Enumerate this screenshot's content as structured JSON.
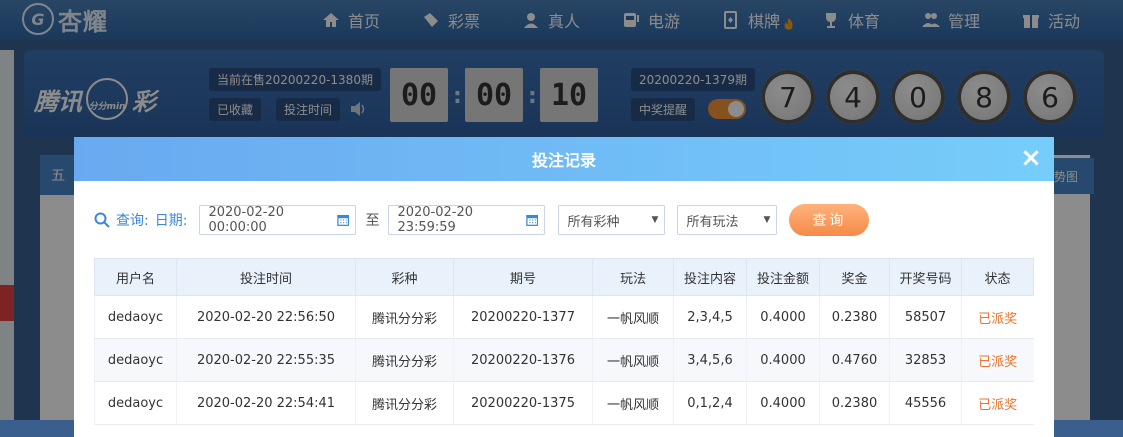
{
  "nav": {
    "logo": "杏耀",
    "items": [
      {
        "label": "首页",
        "icon": "home-icon"
      },
      {
        "label": "彩票",
        "icon": "ticket-icon"
      },
      {
        "label": "真人",
        "icon": "person-icon"
      },
      {
        "label": "电游",
        "icon": "slot-machine-icon"
      },
      {
        "label": "棋牌",
        "icon": "card-icon"
      },
      {
        "label": "体育",
        "icon": "trophy-icon"
      },
      {
        "label": "管理",
        "icon": "users-icon"
      },
      {
        "label": "活动",
        "icon": "gift-icon"
      }
    ]
  },
  "lottery": {
    "brand": "腾讯",
    "brand_suffix": "彩",
    "brand_clock": "分分min",
    "current_period": "当前在售20200220-1380期",
    "collected": "已收藏",
    "bet_time": "投注时间",
    "countdown": [
      "00",
      "00",
      "10"
    ],
    "last_period": "20200220-1379期",
    "win_alert": "中奖提醒",
    "balls": [
      "7",
      "4",
      "0",
      "8",
      "6"
    ]
  },
  "background": {
    "left_tab": "五",
    "right_tab": "势图"
  },
  "modal": {
    "title": "投注记录",
    "close": "×",
    "query_label": "查询:",
    "date_label": "日期:",
    "start_date": "2020-02-20 00:00:00",
    "to": "至",
    "end_date": "2020-02-20 23:59:59",
    "lottery_select": "所有彩种",
    "play_select": "所有玩法",
    "query_button": "查询",
    "columns": [
      "用户名",
      "投注时间",
      "彩种",
      "期号",
      "玩法",
      "投注内容",
      "投注金额",
      "奖金",
      "开奖号码",
      "状态"
    ],
    "rows": [
      [
        "dedaoyc",
        "2020-02-20 22:56:50",
        "腾讯分分彩",
        "20200220-1377",
        "一帆风顺",
        "2,3,4,5",
        "0.4000",
        "0.2380",
        "58507",
        "已派奖"
      ],
      [
        "dedaoyc",
        "2020-02-20 22:55:35",
        "腾讯分分彩",
        "20200220-1376",
        "一帆风顺",
        "3,4,5,6",
        "0.4000",
        "0.4760",
        "32853",
        "已派奖"
      ],
      [
        "dedaoyc",
        "2020-02-20 22:54:41",
        "腾讯分分彩",
        "20200220-1375",
        "一帆风顺",
        "0,1,2,4",
        "0.4000",
        "0.2380",
        "45556",
        "已派奖"
      ]
    ]
  },
  "colors": {
    "header_gradient_start": "#69a9f0",
    "header_gradient_end": "#76cdfa",
    "accent_orange": "#f58a4a",
    "link_blue": "#3b87d9"
  }
}
